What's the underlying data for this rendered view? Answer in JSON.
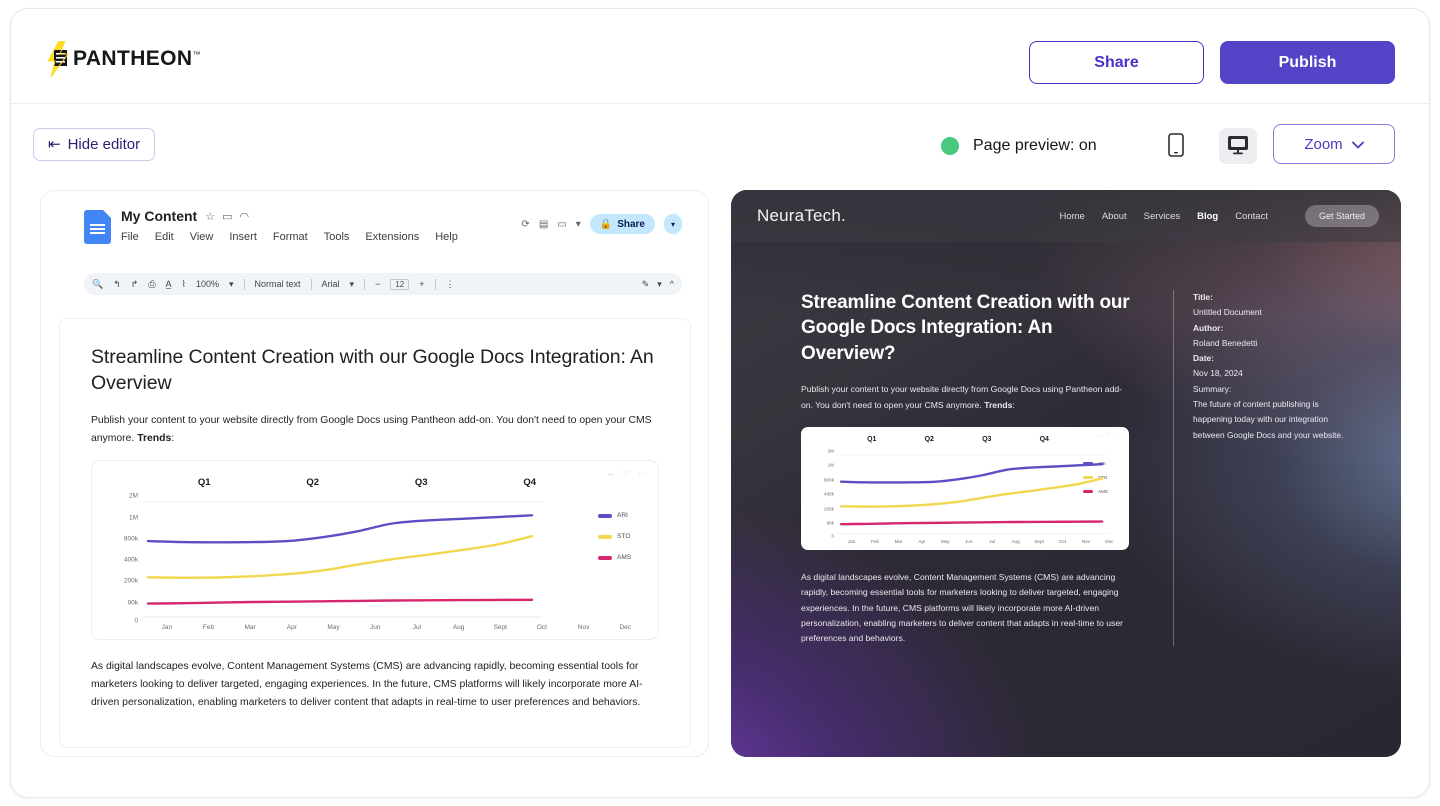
{
  "app": {
    "brand": "PANTHEON",
    "brand_tm": "™"
  },
  "topbar": {
    "share_label": "Share",
    "publish_label": "Publish"
  },
  "toolbar": {
    "hide_editor_label": "Hide editor",
    "hide_editor_icon": "collapse-left-icon",
    "preview_status": "Page preview: on",
    "status_dot_color": "#4ac97e",
    "mobile_icon": "mobile-device-icon",
    "desktop_icon": "desktop-device-icon",
    "zoom_label": "Zoom",
    "zoom_caret": "⌄"
  },
  "editor": {
    "gdoc": {
      "doc_title": "My Content",
      "title_icons": [
        "star-icon",
        "folder-icon",
        "cloud-icon"
      ],
      "menu": [
        "File",
        "Edit",
        "View",
        "Insert",
        "Format",
        "Tools",
        "Extensions",
        "Help"
      ],
      "header_icons": [
        "history-icon",
        "comment-icon",
        "meet-icon",
        "caret-down-icon"
      ],
      "share_label": "Share",
      "share_lock_icon": "lock-icon",
      "toolbar_items": [
        "search-icon",
        "undo-icon",
        "redo-icon",
        "print-icon",
        "spellcheck-icon",
        "paint-format-icon"
      ],
      "zoom_value": "100%",
      "style_value": "Normal text",
      "font_value": "Arial",
      "font_size_minus": "−",
      "font_size": "12",
      "font_size_plus": "+",
      "more_icon": "kebab-menu-icon",
      "pen_icon": "edit-mode-icon",
      "collapse_icon": "chevron-up-icon"
    },
    "document": {
      "heading": "Streamline Content Creation with our Google Docs Integration: An Overview",
      "intro_text": "Publish your content to your website directly from Google Docs using Pantheon add-on. You don't need to open your CMS anymore. ",
      "intro_bold": "Trends",
      "intro_colon": ":",
      "body_text": "As digital landscapes evolve, Content Management Systems (CMS) are advancing rapidly, becoming essential tools for marketers looking to deliver targeted, engaging experiences. In the future, CMS platforms will likely incorporate more AI-driven personalization, enabling marketers to deliver content that adapts in real-time to user preferences and behaviors."
    }
  },
  "preview": {
    "site_brand": "NeuraTech.",
    "nav": [
      {
        "label": "Home",
        "active": false
      },
      {
        "label": "About",
        "active": false
      },
      {
        "label": "Services",
        "active": false
      },
      {
        "label": "Blog",
        "active": true
      },
      {
        "label": "Contact",
        "active": false
      }
    ],
    "cta_label": "Get Started",
    "heading": "Streamline Content Creation with our Google Docs Integration: An Overview?",
    "intro_text": "Publish your content to your website directly from Google Docs using Pantheon add-on. You don't need to open your CMS anymore. ",
    "intro_bold": "Trends",
    "intro_colon": ":",
    "body_text": "As digital landscapes evolve, Content Management Systems (CMS) are advancing rapidly, becoming essential tools for marketers looking to deliver targeted, engaging experiences. In the future, CMS platforms will likely incorporate more AI-driven personalization, enabling marketers to deliver content that adapts in real-time to user preferences and behaviors.",
    "meta": {
      "title_key": "Title:",
      "title_value": "Untitled Document",
      "author_key": "Author:",
      "author_value": "Roland Benedetti",
      "date_key": "Date:",
      "date_value": "Nov 18, 2024",
      "summary_key": "Summary:",
      "summary_value": "The future of content publishing is happening today with our integration between Google Docs and your website."
    }
  },
  "chart_data": {
    "type": "line",
    "title": "",
    "xlabel": "",
    "ylabel": "",
    "groups": [
      "Q1",
      "Q2",
      "Q3",
      "Q4"
    ],
    "categories": [
      "Jan",
      "Feb",
      "Mar",
      "Apr",
      "May",
      "Jun",
      "Jul",
      "Aug",
      "Sept",
      "Oct",
      "Nov",
      "Dec"
    ],
    "ytick_labels": [
      "2M",
      "1M",
      "800k",
      "400k",
      "200k",
      "90k",
      "0"
    ],
    "ytick_positions": [
      100,
      83,
      66,
      49,
      32,
      15,
      0
    ],
    "grid": false,
    "legend_position": "right",
    "series": [
      {
        "name": "ARI",
        "color": "#5b4fc4",
        "values": [
          800000,
          780000,
          775000,
          780000,
          800000,
          840000,
          900000,
          980000,
          1060000,
          1140000,
          1230000,
          1320000
        ]
      },
      {
        "name": "STO",
        "color": "#f2d74e",
        "values": [
          230000,
          225000,
          228000,
          240000,
          262000,
          300000,
          360000,
          430000,
          520000,
          620000,
          730000,
          850000
        ]
      },
      {
        "name": "AMS",
        "color": "#d6276e",
        "values": [
          70000,
          72000,
          75000,
          78000,
          80000,
          82000,
          84000,
          86000,
          87000,
          88000,
          89000,
          90000
        ]
      }
    ],
    "actions": [
      "expand-icon",
      "heart-icon",
      "more-icon"
    ]
  }
}
